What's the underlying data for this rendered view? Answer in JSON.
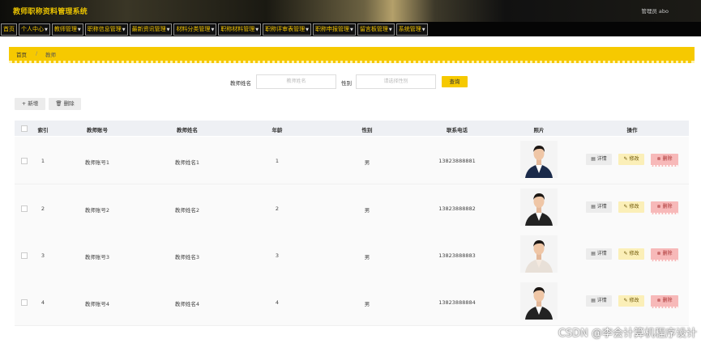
{
  "header": {
    "title": "教师职称资料管理系统",
    "admin": "管理员 abo"
  },
  "nav": [
    {
      "label": "首页",
      "caret": false
    },
    {
      "label": "个人中心",
      "caret": true
    },
    {
      "label": "教师管理",
      "caret": true
    },
    {
      "label": "职称信息管理",
      "caret": true
    },
    {
      "label": "最新资讯管理",
      "caret": true
    },
    {
      "label": "材料分类管理",
      "caret": true
    },
    {
      "label": "职称材料管理",
      "caret": true
    },
    {
      "label": "职称评审表管理",
      "caret": true
    },
    {
      "label": "职称申报管理",
      "caret": true
    },
    {
      "label": "留言板管理",
      "caret": true
    },
    {
      "label": "系统管理",
      "caret": true
    }
  ],
  "breadcrumb": {
    "home": "首页",
    "separator": "/",
    "current": "教师"
  },
  "search": {
    "name_label": "教师姓名",
    "name_placeholder": "教师姓名",
    "gender_label": "性别",
    "gender_placeholder": "请选择性别",
    "button": "查询"
  },
  "toolbar": {
    "add": "+ 新增",
    "delete": "删除"
  },
  "table": {
    "headers": [
      "索引",
      "教师账号",
      "教师姓名",
      "年龄",
      "性别",
      "联系电话",
      "照片",
      "操作"
    ],
    "rows": [
      {
        "index": "1",
        "account": "教师账号1",
        "name": "教师姓名1",
        "age": "1",
        "gender": "男",
        "phone": "13823888881"
      },
      {
        "index": "2",
        "account": "教师账号2",
        "name": "教师姓名2",
        "age": "2",
        "gender": "男",
        "phone": "13823888882"
      },
      {
        "index": "3",
        "account": "教师账号3",
        "name": "教师姓名3",
        "age": "3",
        "gender": "男",
        "phone": "13823888883"
      },
      {
        "index": "4",
        "account": "教师账号4",
        "name": "教师姓名4",
        "age": "4",
        "gender": "男",
        "phone": "13823888884"
      }
    ],
    "actions": {
      "detail": "详情",
      "edit": "修改",
      "delete": "删除"
    }
  },
  "watermark": "CSDN @李会计算机程序设计",
  "colors": {
    "accent": "#f6c900",
    "nav_bg": "#050505",
    "nav_text": "#f2c400"
  }
}
